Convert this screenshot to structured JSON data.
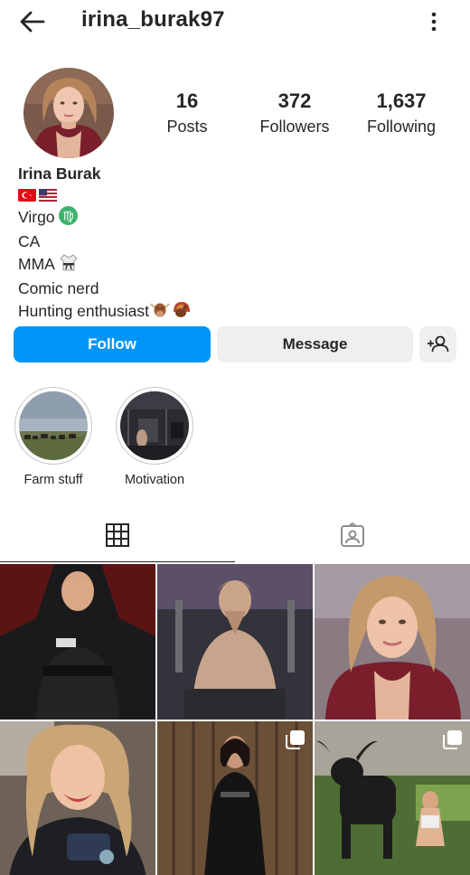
{
  "header": {
    "username": "irina_burak97",
    "back_icon": "arrow-left-icon",
    "menu_icon": "more-vertical-icon"
  },
  "profile": {
    "display_name": "Irina Burak",
    "stats": {
      "posts": "16",
      "posts_label": "Posts",
      "followers": "372",
      "followers_label": "Followers",
      "following": "1,637",
      "following_label": "Following"
    },
    "bio": {
      "flags": [
        "flag-turkey",
        "flag-usa"
      ],
      "line_sign": "Virgo",
      "line_location": "CA",
      "line_sport": "MMA",
      "line_hobby": "Comic nerd",
      "line_hunting": "Hunting enthusiast"
    }
  },
  "actions": {
    "follow_label": "Follow",
    "message_label": "Message",
    "add_user_icon": "add-user-icon"
  },
  "highlights": [
    {
      "label": "Farm stuff"
    },
    {
      "label": "Motivation"
    }
  ],
  "tabs": {
    "grid_icon": "grid-icon",
    "tagged_icon": "tagged-icon"
  },
  "colors": {
    "primary": "#0095f6",
    "secondary_button": "#efefef",
    "text": "#262626",
    "divider": "#dbdbdb"
  }
}
